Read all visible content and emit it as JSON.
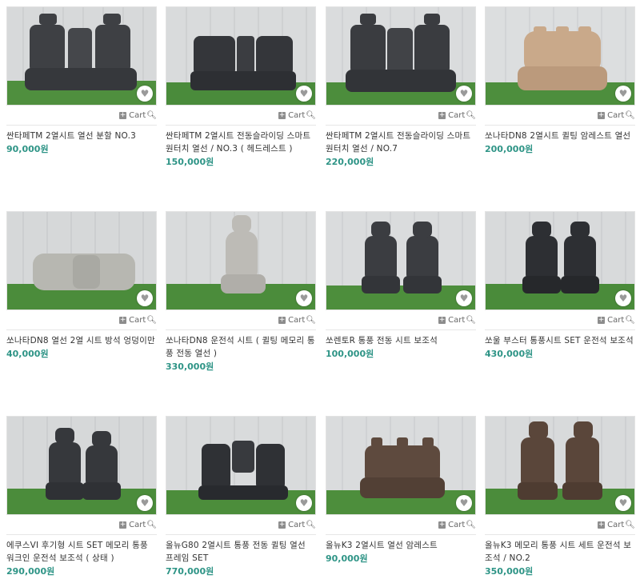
{
  "products": [
    {
      "title": "싼타페TM 2열시트 열선 분할 NO.3",
      "price": "90,000원",
      "cart_label": "Cart",
      "seat_color": "#3e4044",
      "heart_icon": "heart-icon"
    },
    {
      "title": "싼타페TM 2열시트 전동슬라이딩 스마트 원터치 열선 / NO.3 ( 헤드레스트 )",
      "price": "150,000원",
      "cart_label": "Cart",
      "seat_color": "#34363a",
      "heart_icon": "heart-icon"
    },
    {
      "title": "싼타페TM 2열시트 전동슬라이딩 스마트원터치 열선 / NO.7",
      "price": "220,000원",
      "cart_label": "Cart",
      "seat_color": "#3a3c40",
      "heart_icon": "heart-icon"
    },
    {
      "title": "쏘나타DN8 2열시트 퀼팅 암레스트 열선",
      "price": "200,000원",
      "cart_label": "Cart",
      "seat_color": "#c9a98a",
      "heart_icon": "heart-icon"
    },
    {
      "title": "쏘나타DN8 열선 2열 시트 방석 엉덩이만",
      "price": "40,000원",
      "cart_label": "Cart",
      "seat_color": "#b7b7b1",
      "heart_icon": "heart-icon"
    },
    {
      "title": "쏘나타DN8 운전석 시트 ( 퀼팅 메모리 통풍 전동 열선 )",
      "price": "330,000원",
      "cart_label": "Cart",
      "seat_color": "#bdbbb6",
      "heart_icon": "heart-icon"
    },
    {
      "title": "쏘렌토R 통풍 전동 시트 보조석",
      "price": "100,000원",
      "cart_label": "Cart",
      "seat_color": "#3b3d41",
      "heart_icon": "heart-icon"
    },
    {
      "title": "쏘울 부스터 통풍시트 SET 운전석 보조석",
      "price": "430,000원",
      "cart_label": "Cart",
      "seat_color": "#2d2f33",
      "heart_icon": "heart-icon"
    },
    {
      "title": "에쿠스VI 후기형 시트 SET 메모리 통풍 워크인 운전석 보조석 ( 상태 )",
      "price": "290,000원",
      "cart_label": "Cart",
      "seat_color": "#36383c",
      "heart_icon": "heart-icon"
    },
    {
      "title": "올뉴G80 2열시트 통풍 전동 퀼팅 열선 프레임 SET",
      "price": "770,000원",
      "cart_label": "Cart",
      "seat_color": "#2f3135",
      "heart_icon": "heart-icon"
    },
    {
      "title": "올뉴K3 2열시트 열선 암레스트",
      "price": "90,000원",
      "cart_label": "Cart",
      "seat_color": "#5e4a3e",
      "heart_icon": "heart-icon"
    },
    {
      "title": "올뉴K3 메모리 통풍 시트 세트 운전석 보조석 / NO.2",
      "price": "350,000원",
      "cart_label": "Cart",
      "seat_color": "#5a463a",
      "heart_icon": "heart-icon"
    }
  ],
  "colors": {
    "price": "#2e9486",
    "wall": "#d8dadb",
    "grass": "#4f8f3e"
  }
}
